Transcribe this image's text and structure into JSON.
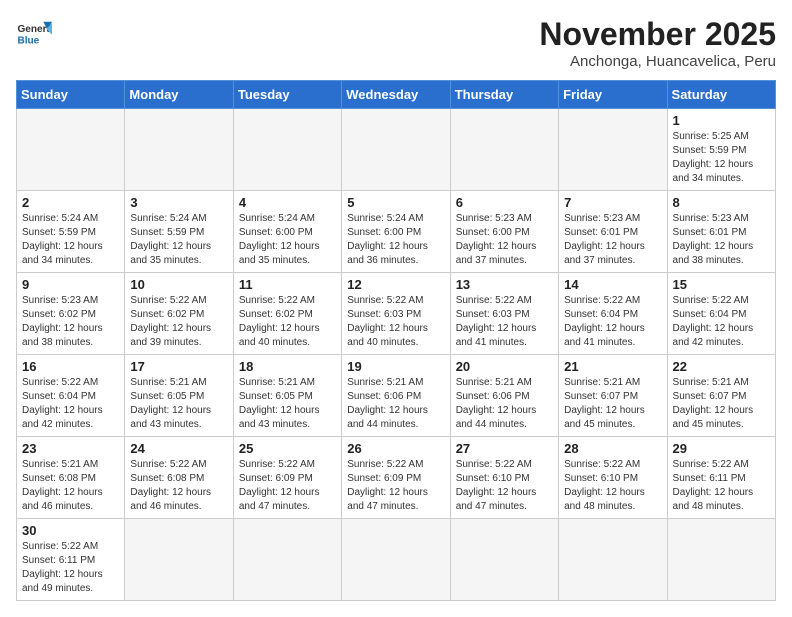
{
  "header": {
    "logo_general": "General",
    "logo_blue": "Blue",
    "month_title": "November 2025",
    "location": "Anchonga, Huancavelica, Peru"
  },
  "days_of_week": [
    "Sunday",
    "Monday",
    "Tuesday",
    "Wednesday",
    "Thursday",
    "Friday",
    "Saturday"
  ],
  "weeks": [
    [
      {
        "day": "",
        "info": ""
      },
      {
        "day": "",
        "info": ""
      },
      {
        "day": "",
        "info": ""
      },
      {
        "day": "",
        "info": ""
      },
      {
        "day": "",
        "info": ""
      },
      {
        "day": "",
        "info": ""
      },
      {
        "day": "1",
        "info": "Sunrise: 5:25 AM\nSunset: 5:59 PM\nDaylight: 12 hours\nand 34 minutes."
      }
    ],
    [
      {
        "day": "2",
        "info": "Sunrise: 5:24 AM\nSunset: 5:59 PM\nDaylight: 12 hours\nand 34 minutes."
      },
      {
        "day": "3",
        "info": "Sunrise: 5:24 AM\nSunset: 5:59 PM\nDaylight: 12 hours\nand 35 minutes."
      },
      {
        "day": "4",
        "info": "Sunrise: 5:24 AM\nSunset: 6:00 PM\nDaylight: 12 hours\nand 35 minutes."
      },
      {
        "day": "5",
        "info": "Sunrise: 5:24 AM\nSunset: 6:00 PM\nDaylight: 12 hours\nand 36 minutes."
      },
      {
        "day": "6",
        "info": "Sunrise: 5:23 AM\nSunset: 6:00 PM\nDaylight: 12 hours\nand 37 minutes."
      },
      {
        "day": "7",
        "info": "Sunrise: 5:23 AM\nSunset: 6:01 PM\nDaylight: 12 hours\nand 37 minutes."
      },
      {
        "day": "8",
        "info": "Sunrise: 5:23 AM\nSunset: 6:01 PM\nDaylight: 12 hours\nand 38 minutes."
      }
    ],
    [
      {
        "day": "9",
        "info": "Sunrise: 5:23 AM\nSunset: 6:02 PM\nDaylight: 12 hours\nand 38 minutes."
      },
      {
        "day": "10",
        "info": "Sunrise: 5:22 AM\nSunset: 6:02 PM\nDaylight: 12 hours\nand 39 minutes."
      },
      {
        "day": "11",
        "info": "Sunrise: 5:22 AM\nSunset: 6:02 PM\nDaylight: 12 hours\nand 40 minutes."
      },
      {
        "day": "12",
        "info": "Sunrise: 5:22 AM\nSunset: 6:03 PM\nDaylight: 12 hours\nand 40 minutes."
      },
      {
        "day": "13",
        "info": "Sunrise: 5:22 AM\nSunset: 6:03 PM\nDaylight: 12 hours\nand 41 minutes."
      },
      {
        "day": "14",
        "info": "Sunrise: 5:22 AM\nSunset: 6:04 PM\nDaylight: 12 hours\nand 41 minutes."
      },
      {
        "day": "15",
        "info": "Sunrise: 5:22 AM\nSunset: 6:04 PM\nDaylight: 12 hours\nand 42 minutes."
      }
    ],
    [
      {
        "day": "16",
        "info": "Sunrise: 5:22 AM\nSunset: 6:04 PM\nDaylight: 12 hours\nand 42 minutes."
      },
      {
        "day": "17",
        "info": "Sunrise: 5:21 AM\nSunset: 6:05 PM\nDaylight: 12 hours\nand 43 minutes."
      },
      {
        "day": "18",
        "info": "Sunrise: 5:21 AM\nSunset: 6:05 PM\nDaylight: 12 hours\nand 43 minutes."
      },
      {
        "day": "19",
        "info": "Sunrise: 5:21 AM\nSunset: 6:06 PM\nDaylight: 12 hours\nand 44 minutes."
      },
      {
        "day": "20",
        "info": "Sunrise: 5:21 AM\nSunset: 6:06 PM\nDaylight: 12 hours\nand 44 minutes."
      },
      {
        "day": "21",
        "info": "Sunrise: 5:21 AM\nSunset: 6:07 PM\nDaylight: 12 hours\nand 45 minutes."
      },
      {
        "day": "22",
        "info": "Sunrise: 5:21 AM\nSunset: 6:07 PM\nDaylight: 12 hours\nand 45 minutes."
      }
    ],
    [
      {
        "day": "23",
        "info": "Sunrise: 5:21 AM\nSunset: 6:08 PM\nDaylight: 12 hours\nand 46 minutes."
      },
      {
        "day": "24",
        "info": "Sunrise: 5:22 AM\nSunset: 6:08 PM\nDaylight: 12 hours\nand 46 minutes."
      },
      {
        "day": "25",
        "info": "Sunrise: 5:22 AM\nSunset: 6:09 PM\nDaylight: 12 hours\nand 47 minutes."
      },
      {
        "day": "26",
        "info": "Sunrise: 5:22 AM\nSunset: 6:09 PM\nDaylight: 12 hours\nand 47 minutes."
      },
      {
        "day": "27",
        "info": "Sunrise: 5:22 AM\nSunset: 6:10 PM\nDaylight: 12 hours\nand 47 minutes."
      },
      {
        "day": "28",
        "info": "Sunrise: 5:22 AM\nSunset: 6:10 PM\nDaylight: 12 hours\nand 48 minutes."
      },
      {
        "day": "29",
        "info": "Sunrise: 5:22 AM\nSunset: 6:11 PM\nDaylight: 12 hours\nand 48 minutes."
      }
    ],
    [
      {
        "day": "30",
        "info": "Sunrise: 5:22 AM\nSunset: 6:11 PM\nDaylight: 12 hours\nand 49 minutes."
      },
      {
        "day": "",
        "info": ""
      },
      {
        "day": "",
        "info": ""
      },
      {
        "day": "",
        "info": ""
      },
      {
        "day": "",
        "info": ""
      },
      {
        "day": "",
        "info": ""
      },
      {
        "day": "",
        "info": ""
      }
    ]
  ]
}
